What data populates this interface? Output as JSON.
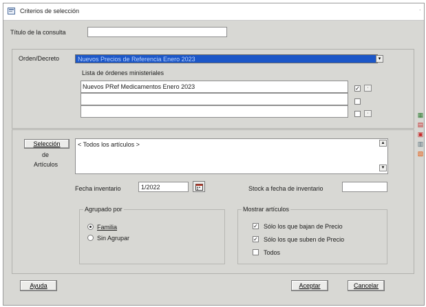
{
  "window": {
    "title": "Criterios de selección",
    "close": "·"
  },
  "titulo": {
    "label": "Título de la consulta",
    "value": ""
  },
  "orden": {
    "label": "Orden/Decreto",
    "selected": "Nuevos Precios de Referencia Enero 2023",
    "dropdown_glyph": "▾"
  },
  "lista": {
    "label": "Lista de órdenes ministeriales",
    "rows": [
      {
        "text": "Nuevos PRef Medicamentos  Enero 2023",
        "checked": true
      },
      {
        "text": "",
        "checked": false
      },
      {
        "text": "",
        "checked": false
      }
    ],
    "checked_glyph": "✓",
    "side_button": "·"
  },
  "seleccion": {
    "button_label": "Selección",
    "label_de": "de",
    "label_articulos": "Artículos",
    "text": "< Todos los artículos >",
    "scroll_up": "▴",
    "scroll_down": "▾"
  },
  "fecha": {
    "label": "Fecha inventario",
    "value": "1/2022",
    "calendar_icon": "calendar-icon"
  },
  "stock": {
    "label": "Stock a fecha de inventario",
    "value": ""
  },
  "agrupado": {
    "title": "Agrupado por",
    "options": [
      {
        "label": "Familia",
        "selected": true
      },
      {
        "label": "Sin Agrupar",
        "selected": false
      }
    ]
  },
  "mostrar": {
    "title": "Mostrar artículos",
    "options": [
      {
        "label": "Sólo los que bajan de Precio",
        "checked": true
      },
      {
        "label": "Sólo los que suben de Precio",
        "checked": true
      },
      {
        "label": "Todos",
        "checked": false
      }
    ],
    "checked_glyph": "✓"
  },
  "buttons": {
    "ayuda": "Ayuda",
    "aceptar": "Aceptar",
    "cancelar": "Cancelar"
  },
  "side_icons": [
    {
      "name": "excel-icon",
      "glyph": "▦",
      "color": "#2e7d32"
    },
    {
      "name": "pdf-icon",
      "glyph": "▤",
      "color": "#c62828"
    },
    {
      "name": "save-icon",
      "glyph": "▣",
      "color": "#c62828"
    },
    {
      "name": "print-icon",
      "glyph": "▥",
      "color": "#546e7a"
    },
    {
      "name": "export-icon",
      "glyph": "▧",
      "color": "#e65100"
    }
  ],
  "colors": {
    "selection_blue": "#1c57c8",
    "dialog_bg": "#d8d8d4"
  }
}
